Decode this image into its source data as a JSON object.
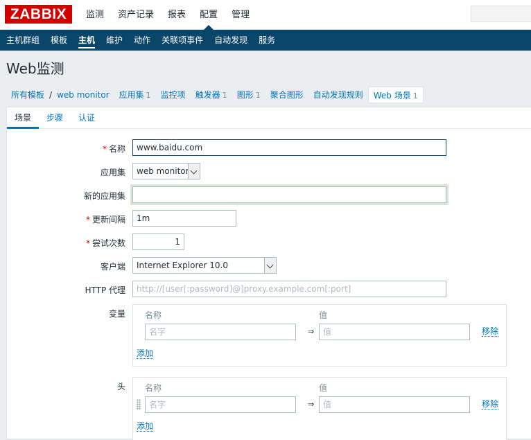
{
  "topbar": {
    "logo": "ZABBIX",
    "menu": [
      "监测",
      "资产记录",
      "报表",
      "配置",
      "管理"
    ],
    "active_index": 3
  },
  "submenu": {
    "items": [
      "主机群组",
      "模板",
      "主机",
      "维护",
      "动作",
      "关联项事件",
      "自动发现",
      "服务"
    ],
    "active_index": 2
  },
  "page": {
    "title": "Web监测"
  },
  "nav": {
    "all_templates": "所有模板",
    "separator": "/",
    "template_name": "web monitor",
    "applications": "应用集",
    "applications_count": "1",
    "items": "监控项",
    "triggers": "触发器",
    "triggers_count": "1",
    "graphs": "图形",
    "graphs_count": "1",
    "screens": "聚合图形",
    "discovery": "自动发现规则",
    "web": "Web 场景",
    "web_count": "1"
  },
  "tabs": [
    "场景",
    "步骤",
    "认证"
  ],
  "form": {
    "required_mark": "*",
    "name_label": "名称",
    "name_value": "www.baidu.com",
    "app_label": "应用集",
    "app_value": "web monitor",
    "new_app_label": "新的应用集",
    "new_app_value": "",
    "interval_label": "更新间隔",
    "interval_value": "1m",
    "attempts_label": "尝试次数",
    "attempts_value": "1",
    "agent_label": "客户端",
    "agent_value": "Internet Explorer 10.0",
    "proxy_label": "HTTP 代理",
    "proxy_placeholder": "http://[user[:password]@]proxy.example.com[:port]",
    "variables_label": "变量",
    "headers_label": "头",
    "col_name": "名称",
    "col_value": "值",
    "name_placeholder": "名字",
    "value_placeholder": "值",
    "arrow": "⇒",
    "remove": "移除",
    "add": "添加"
  }
}
